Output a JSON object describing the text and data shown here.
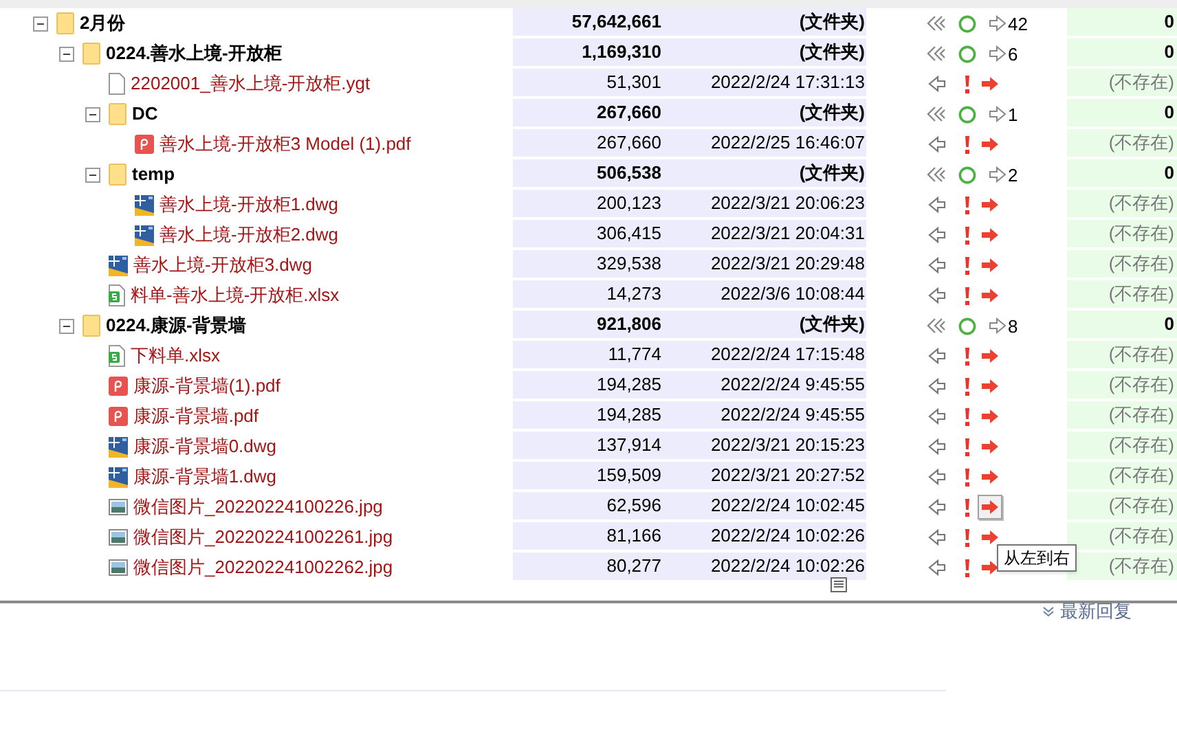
{
  "tree": [
    {
      "kind": "folder",
      "name": "2月份",
      "expanded": true,
      "size": "57,642,661",
      "modified": "(文件夹)",
      "count": "42",
      "target": "0",
      "children": [
        {
          "kind": "folder",
          "name": "0224.善水上境-开放柜",
          "expanded": true,
          "size": "1,169,310",
          "modified": "(文件夹)",
          "count": "6",
          "target": "0",
          "children": [
            {
              "kind": "ygt",
              "name": "2202001_善水上境-开放柜.ygt",
              "size": "51,301",
              "modified": "2022/2/24 17:31:13",
              "target": "(不存在)",
              "hovered": false
            },
            {
              "kind": "folder",
              "name": "DC",
              "expanded": true,
              "size": "267,660",
              "modified": "(文件夹)",
              "count": "1",
              "target": "0",
              "children": [
                {
                  "kind": "pdf",
                  "name": "善水上境-开放柜3 Model (1).pdf",
                  "size": "267,660",
                  "modified": "2022/2/25 16:46:07",
                  "target": "(不存在)",
                  "hovered": false
                }
              ]
            },
            {
              "kind": "folder",
              "name": "temp",
              "expanded": true,
              "size": "506,538",
              "modified": "(文件夹)",
              "count": "2",
              "target": "0",
              "children": [
                {
                  "kind": "dwg",
                  "name": "善水上境-开放柜1.dwg",
                  "size": "200,123",
                  "modified": "2022/3/21 20:06:23",
                  "target": "(不存在)",
                  "hovered": false
                },
                {
                  "kind": "dwg",
                  "name": "善水上境-开放柜2.dwg",
                  "size": "306,415",
                  "modified": "2022/3/21 20:04:31",
                  "target": "(不存在)",
                  "hovered": false
                }
              ]
            },
            {
              "kind": "dwg",
              "name": "善水上境-开放柜3.dwg",
              "size": "329,538",
              "modified": "2022/3/21 20:29:48",
              "target": "(不存在)",
              "hovered": false
            },
            {
              "kind": "xlsx",
              "name": "料单-善水上境-开放柜.xlsx",
              "size": "14,273",
              "modified": "2022/3/6 10:08:44",
              "target": "(不存在)",
              "hovered": false
            }
          ]
        },
        {
          "kind": "folder",
          "name": "0224.康源-背景墙",
          "expanded": true,
          "size": "921,806",
          "modified": "(文件夹)",
          "count": "8",
          "target": "0",
          "children": [
            {
              "kind": "xlsx",
              "name": "下料单.xlsx",
              "size": "11,774",
              "modified": "2022/2/24 17:15:48",
              "target": "(不存在)",
              "hovered": false
            },
            {
              "kind": "pdf",
              "name": "康源-背景墙(1).pdf",
              "size": "194,285",
              "modified": "2022/2/24 9:45:55",
              "target": "(不存在)",
              "hovered": false
            },
            {
              "kind": "pdf",
              "name": "康源-背景墙.pdf",
              "size": "194,285",
              "modified": "2022/2/24 9:45:55",
              "target": "(不存在)",
              "hovered": false
            },
            {
              "kind": "dwg",
              "name": "康源-背景墙0.dwg",
              "size": "137,914",
              "modified": "2022/3/21 20:15:23",
              "target": "(不存在)",
              "hovered": false
            },
            {
              "kind": "dwg",
              "name": "康源-背景墙1.dwg",
              "size": "159,509",
              "modified": "2022/3/21 20:27:52",
              "target": "(不存在)",
              "hovered": false
            },
            {
              "kind": "jpg",
              "name": "微信图片_20220224100226.jpg",
              "size": "62,596",
              "modified": "2022/2/24 10:02:45",
              "target": "(不存在)",
              "hovered": true
            },
            {
              "kind": "jpg",
              "name": "微信图片_202202241002261.jpg",
              "size": "81,166",
              "modified": "2022/2/24 10:02:26",
              "target": "(不存在)",
              "hovered": false
            },
            {
              "kind": "jpg",
              "name": "微信图片_202202241002262.jpg",
              "size": "80,277",
              "modified": "2022/2/24 10:02:26",
              "target": "(不存在)",
              "hovered": false
            }
          ]
        }
      ]
    }
  ],
  "tooltip": "从左到右",
  "latest_replies": "最新回复"
}
